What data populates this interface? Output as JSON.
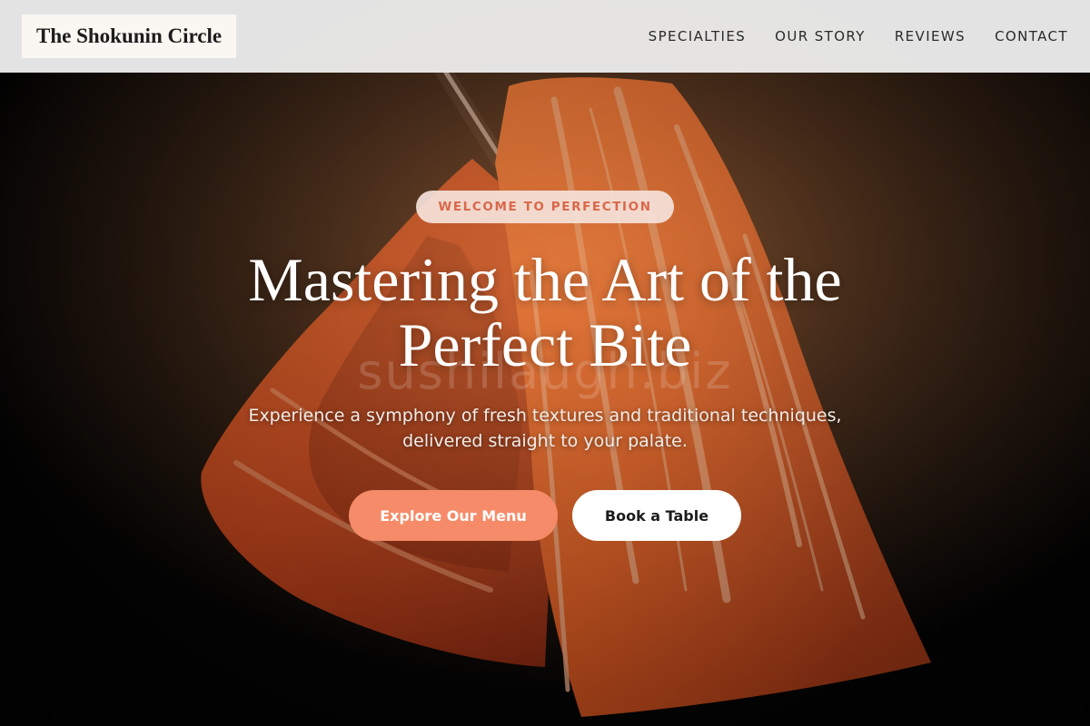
{
  "header": {
    "logo_text": "The Shokunin Circle",
    "nav": [
      {
        "label": "SPECIALTIES"
      },
      {
        "label": "OUR STORY"
      },
      {
        "label": "REVIEWS"
      },
      {
        "label": "CONTACT"
      }
    ]
  },
  "hero": {
    "badge": "WELCOME TO PERFECTION",
    "title_line1": "Mastering the Art of the",
    "title_line2": "Perfect Bite",
    "subtitle_line1": "Experience a symphony of fresh textures and traditional techniques,",
    "subtitle_line2": "delivered straight to your palate.",
    "watermark": "sushilaugh.biz",
    "background_image": "salmon-sashimi-on-chopsticks"
  },
  "actions": {
    "primary_label": "Explore Our Menu",
    "secondary_label": "Book a Table"
  },
  "colors": {
    "accent": "#f58b68",
    "badge_text": "#d9684a",
    "badge_bg": "#f5e2da",
    "header_bg": "#ececec",
    "logo_bg": "#faf6f1"
  }
}
